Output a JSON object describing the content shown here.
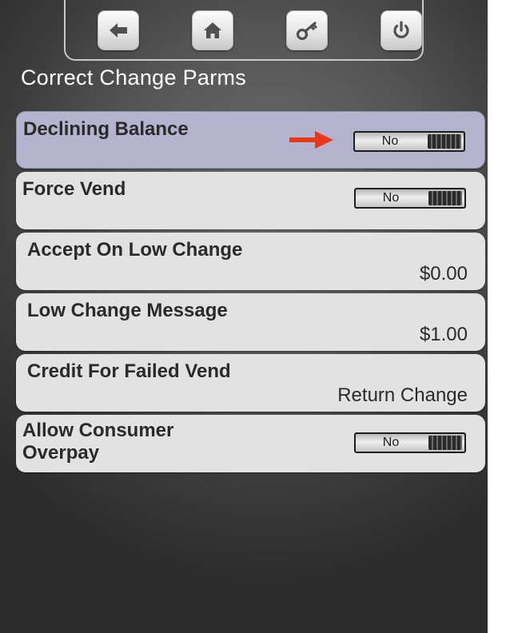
{
  "header": {
    "title": "Correct Change Parms",
    "nav": [
      {
        "icon": "back-arrow-icon"
      },
      {
        "icon": "home-icon"
      },
      {
        "icon": "key-icon"
      },
      {
        "icon": "power-icon"
      }
    ]
  },
  "settings": [
    {
      "label": "Declining Balance",
      "type": "toggle",
      "value": "No",
      "selected": true
    },
    {
      "label": "Force Vend",
      "type": "toggle",
      "value": "No"
    },
    {
      "label": "Accept On Low Change",
      "type": "value",
      "value": "$0.00"
    },
    {
      "label": "Low Change Message",
      "type": "value",
      "value": "$1.00"
    },
    {
      "label": "Credit For Failed Vend",
      "type": "value",
      "value": "Return Change"
    },
    {
      "label": "Allow Consumer\nOverpay",
      "type": "toggle",
      "value": "No"
    }
  ],
  "colors": {
    "selected_row": "#b4b4cf",
    "row": "#e2e2e2",
    "indicator_arrow": "#e8381c"
  }
}
